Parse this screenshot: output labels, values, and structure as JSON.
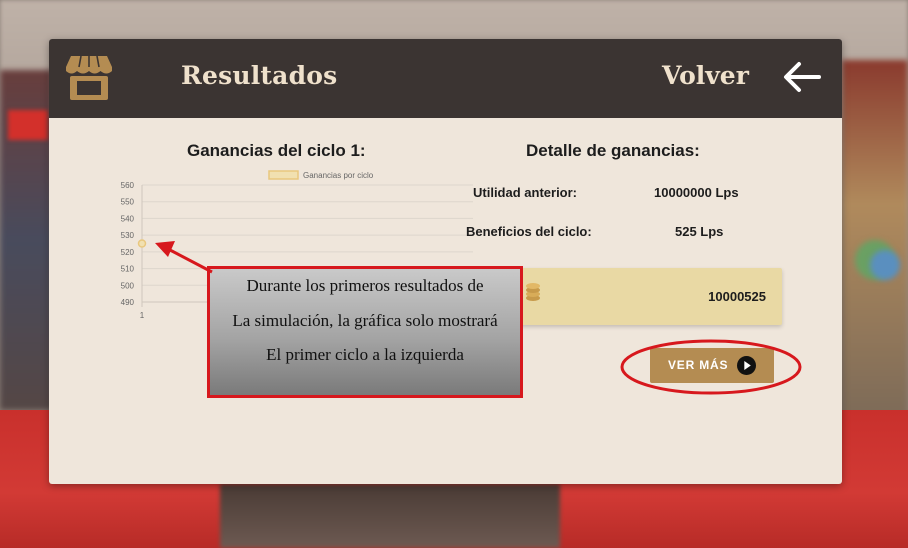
{
  "header": {
    "title": "Resultados",
    "back_label": "Volver"
  },
  "chart": {
    "section_title": "Ganancias del ciclo 1:",
    "legend_label": "Ganancias por ciclo",
    "y_ticks": [
      "560",
      "550",
      "540",
      "530",
      "520",
      "510",
      "500",
      "490"
    ],
    "x_ticks": [
      "1"
    ]
  },
  "chart_data": {
    "type": "line",
    "x": [
      1
    ],
    "categories": [
      "1"
    ],
    "series": [
      {
        "name": "Ganancias por ciclo",
        "values": [
          525
        ]
      }
    ],
    "ylim": [
      490,
      560
    ],
    "legend_position": "top",
    "grid": true,
    "colors": {
      "line": "#e9c77e",
      "fill": "#f1e0b0"
    }
  },
  "details": {
    "section_title": "Detalle de ganancias:",
    "rows": [
      {
        "label": "Utilidad anterior:",
        "value": "10000000 Lps"
      },
      {
        "label": "Beneficios del ciclo:",
        "value": "525 Lps"
      }
    ],
    "total": "10000525"
  },
  "actions": {
    "ver_mas_label": "VER MÁS"
  },
  "tutorial": {
    "lines": [
      "Durante los primeros resultados de",
      "La simulación, la gráfica solo mostrará",
      "El primer ciclo a la izquierda"
    ]
  },
  "colors": {
    "header_bg": "#3b3432",
    "panel_bg": "#efe6db",
    "accent_gold": "#b48c52",
    "total_box_bg": "#e9d9a4",
    "highlight_red": "#d7181d"
  },
  "icons": {
    "store": "store-awning-icon",
    "back": "arrow-left-icon",
    "coin": "coin-stack-icon",
    "play": "play-circle-icon"
  }
}
